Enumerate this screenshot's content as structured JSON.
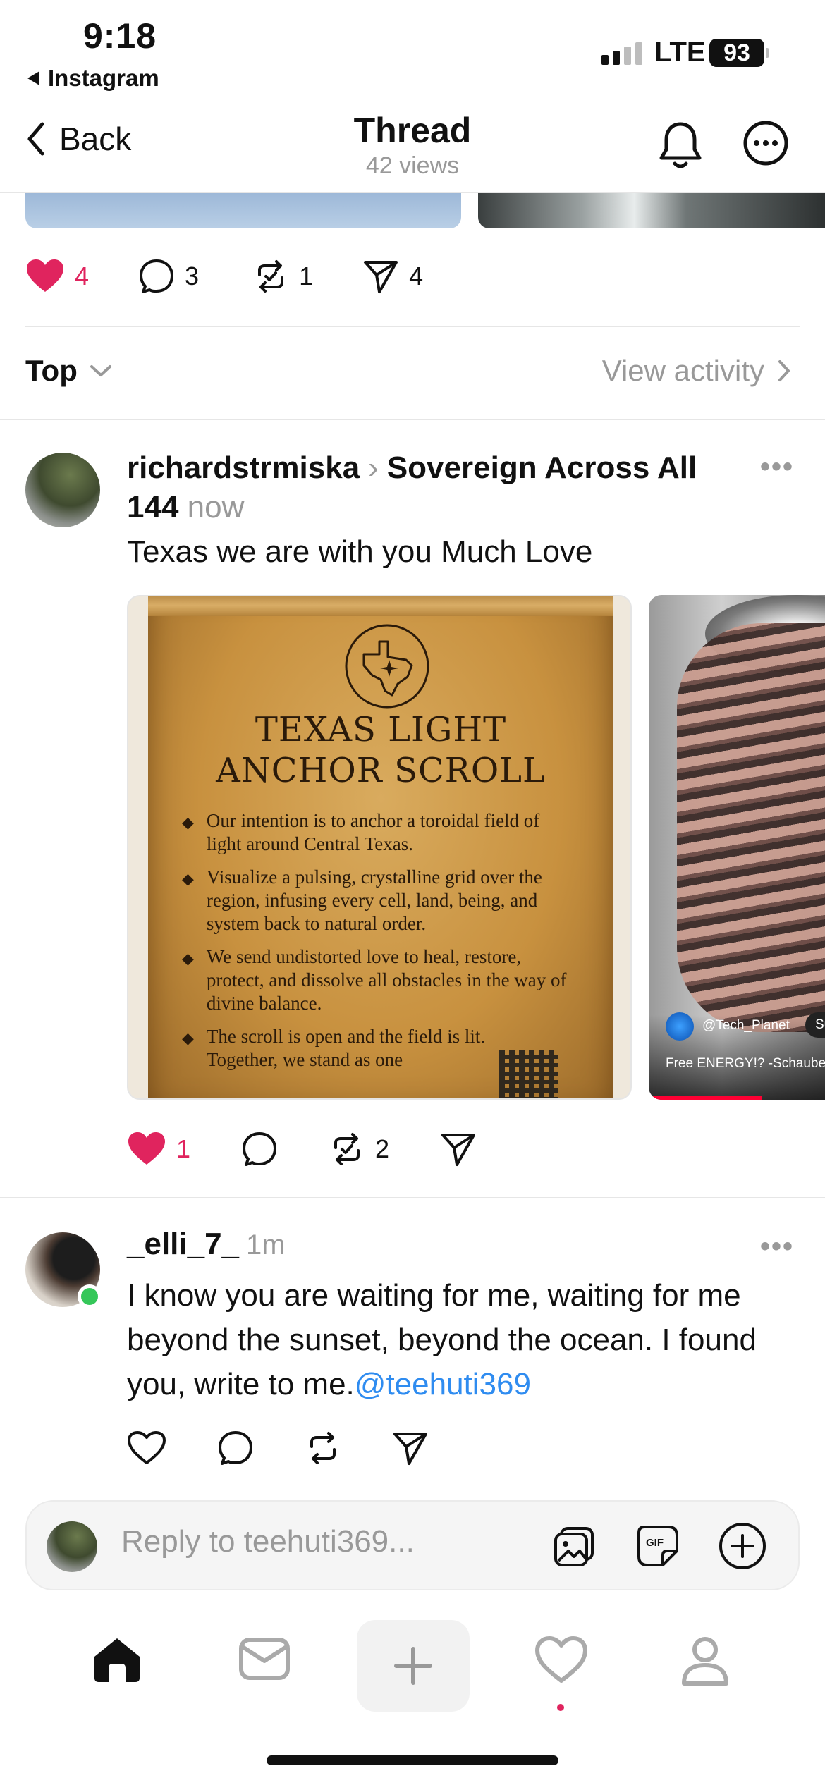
{
  "status_bar": {
    "time": "9:18",
    "back_app": "Instagram",
    "network": "LTE",
    "battery": "93"
  },
  "nav": {
    "back_label": "Back",
    "title": "Thread",
    "views": "42 views"
  },
  "parent_actions": {
    "likes": "4",
    "replies": "3",
    "reposts": "1",
    "shares": "4"
  },
  "sort": {
    "label": "Top",
    "view_activity": "View activity"
  },
  "post1": {
    "username": "richardstrmiska",
    "community": "Sovereign Across All 144",
    "time": "now",
    "text": "Texas we are with you Much Love",
    "scroll": {
      "title_line1": "TEXAS LIGHT",
      "title_line2": "ANCHOR SCROLL",
      "items": [
        "Our intention is to anchor a toroidal field of light around Central Texas.",
        "Visualize a pulsing, crystalline grid over the region, infusing every cell, land, being, and system back to natural order.",
        "We send undistorted love to heal, restore, protect, and dissolve all obstacles in the way of divine balance.",
        "The scroll is open and the field is lit. Together, we stand as one"
      ]
    },
    "video": {
      "handle": "@Tech_Planet",
      "badge": "Su",
      "caption": "Free ENERGY!? -Schauberg"
    },
    "actions": {
      "likes": "1",
      "reposts": "2"
    }
  },
  "post2": {
    "username": "_elli_7_",
    "time": "1m",
    "text": "I know you are waiting for me, waiting for me beyond the sunset, beyond the ocean. I found you, write to me.",
    "mention": "@teehuti369"
  },
  "reply": {
    "placeholder": "Reply to teehuti369..."
  },
  "tabbar": {
    "items": [
      "home-icon",
      "inbox-icon",
      "compose-icon",
      "heart-icon",
      "profile-icon"
    ]
  },
  "colors": {
    "like_red": "#e0245e",
    "mention_blue": "#2f8cf0",
    "muted": "#999999",
    "online": "#35c759"
  }
}
